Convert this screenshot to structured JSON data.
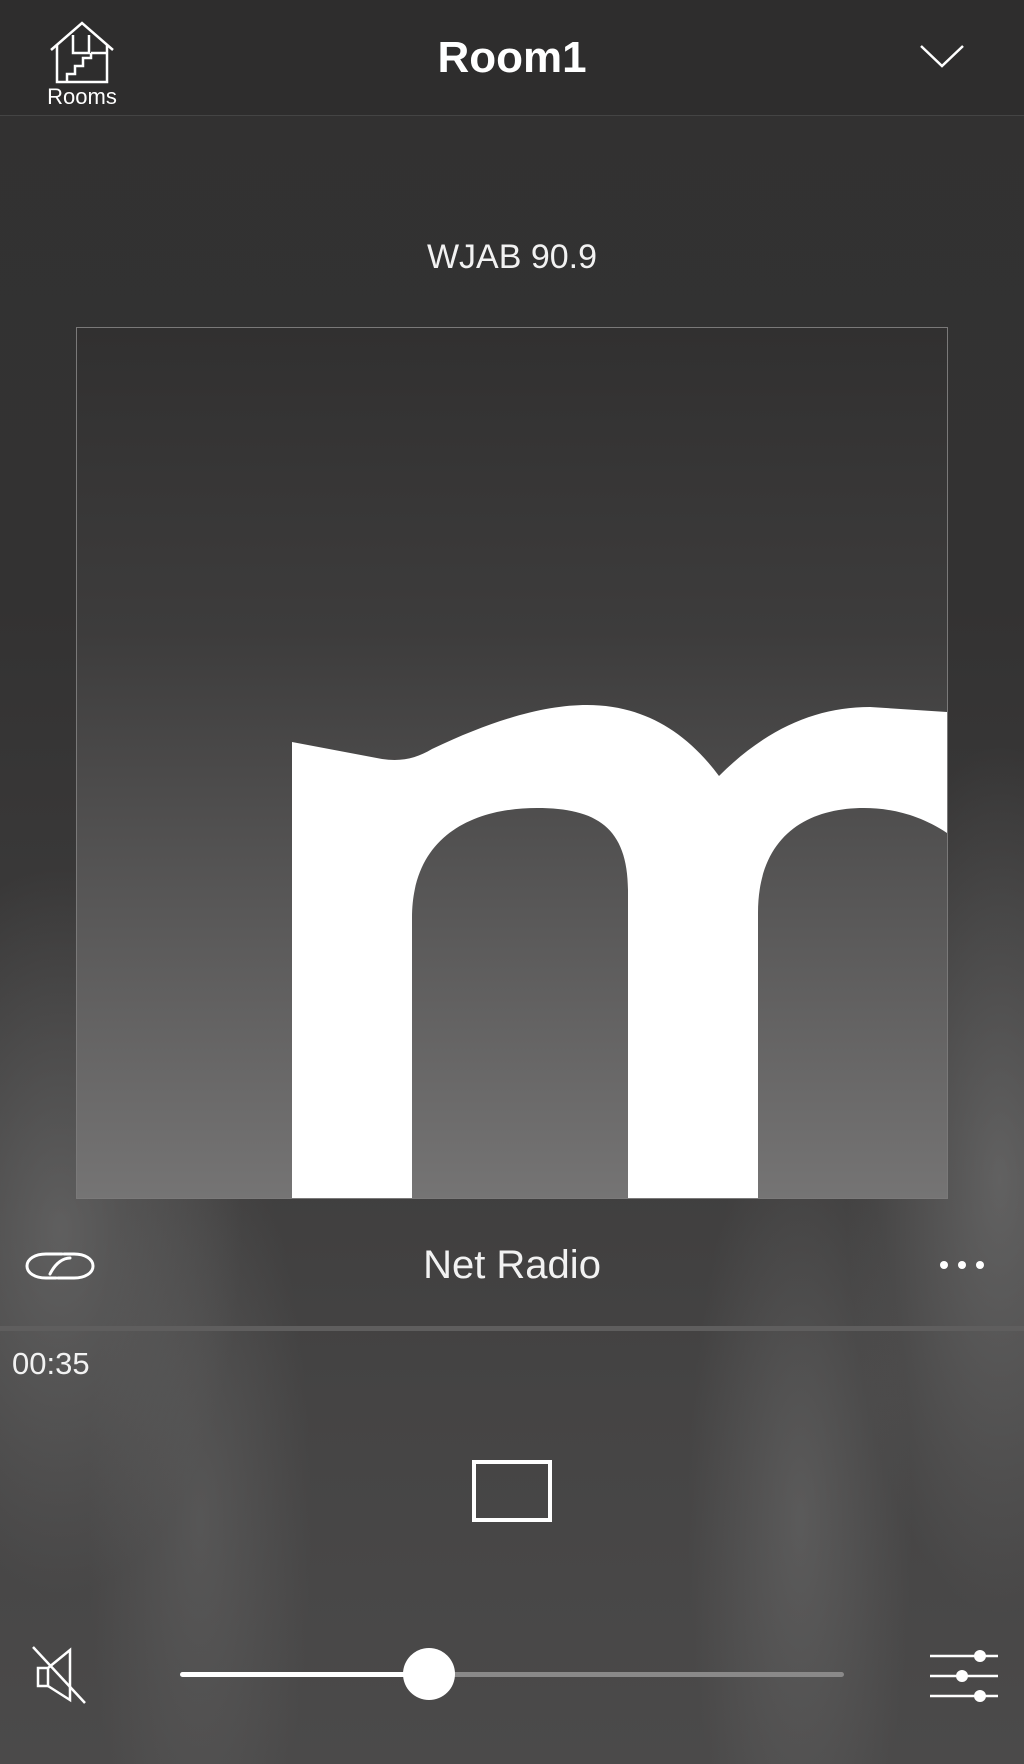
{
  "header": {
    "rooms_label": "Rooms",
    "title": "Room1",
    "collapse_icon": "chevron-down-icon"
  },
  "now_playing": {
    "station": "WJAB 90.9",
    "album_art_letter": "m",
    "source": "Net Radio",
    "elapsed": "00:35"
  },
  "controls": {
    "link_icon": "link-icon",
    "more_icon": "more-icon",
    "stop_icon": "stop-icon",
    "mute_icon": "speaker-muted-icon",
    "equalizer_icon": "equalizer-icon"
  },
  "volume": {
    "level": 0.375
  },
  "colors": {
    "accent": "#ffffff",
    "background": "#2f2e2e",
    "track_inactive": "#8a8989"
  }
}
